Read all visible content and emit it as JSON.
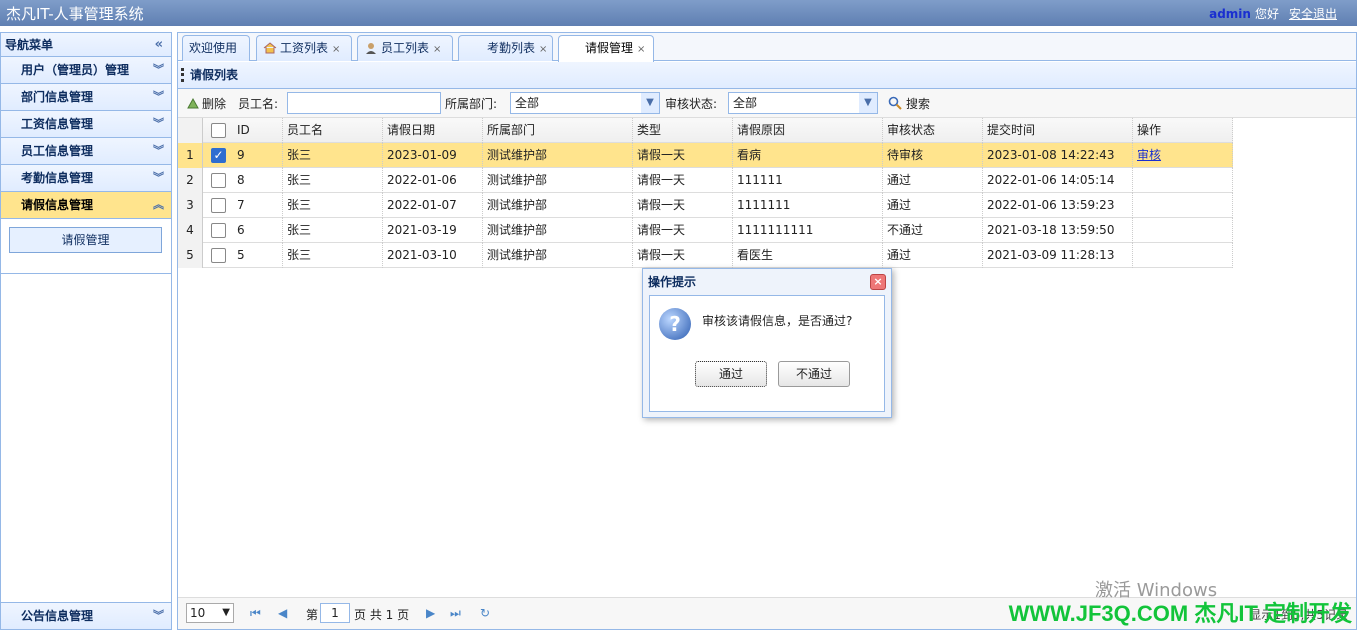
{
  "app": {
    "title": "杰凡IT-人事管理系统",
    "user": "admin",
    "greeting": "您好",
    "logout": "安全退出"
  },
  "sidebar": {
    "title": "导航菜单",
    "items": [
      {
        "label": "用户（管理员）管理"
      },
      {
        "label": "部门信息管理"
      },
      {
        "label": "工资信息管理"
      },
      {
        "label": "员工信息管理"
      },
      {
        "label": "考勤信息管理"
      },
      {
        "label": "请假信息管理"
      }
    ],
    "active_sub": "请假管理",
    "bottom_item": "公告信息管理"
  },
  "tabs": [
    {
      "label": "欢迎使用"
    },
    {
      "label": "工资列表"
    },
    {
      "label": "员工列表"
    },
    {
      "label": "考勤列表"
    },
    {
      "label": "请假管理"
    }
  ],
  "panel": {
    "title": "请假列表"
  },
  "toolbar": {
    "delete": "删除",
    "name_label": "员工名:",
    "name_value": "",
    "dept_label": "所属部门:",
    "dept_value": "全部",
    "status_label": "审核状态:",
    "status_value": "全部",
    "search": "搜索"
  },
  "table": {
    "columns": [
      "ID",
      "员工名",
      "请假日期",
      "所属部门",
      "类型",
      "请假原因",
      "审核状态",
      "提交时间",
      "操作"
    ],
    "rows": [
      {
        "num": "1",
        "id": "9",
        "name": "张三",
        "date": "2023-01-09",
        "dept": "测试维护部",
        "type": "请假一天",
        "reason": "看病",
        "status": "待审核",
        "time": "2023-01-08 14:22:43",
        "action": "审核",
        "checked": true
      },
      {
        "num": "2",
        "id": "8",
        "name": "张三",
        "date": "2022-01-06",
        "dept": "测试维护部",
        "type": "请假一天",
        "reason": "111111",
        "status": "通过",
        "time": "2022-01-06 14:05:14",
        "action": "",
        "checked": false
      },
      {
        "num": "3",
        "id": "7",
        "name": "张三",
        "date": "2022-01-07",
        "dept": "测试维护部",
        "type": "请假一天",
        "reason": "1111111",
        "status": "通过",
        "time": "2022-01-06 13:59:23",
        "action": "",
        "checked": false
      },
      {
        "num": "4",
        "id": "6",
        "name": "张三",
        "date": "2021-03-19",
        "dept": "测试维护部",
        "type": "请假一天",
        "reason": "1111111111",
        "status": "不通过",
        "time": "2021-03-18 13:59:50",
        "action": "",
        "checked": false
      },
      {
        "num": "5",
        "id": "5",
        "name": "张三",
        "date": "2021-03-10",
        "dept": "测试维护部",
        "type": "请假一天",
        "reason": "看医生",
        "status": "通过",
        "time": "2021-03-09 11:28:13",
        "action": "",
        "checked": false
      }
    ]
  },
  "pager": {
    "size": "10",
    "page_prefix": "第",
    "page": "1",
    "page_suffix": "页 共 1 页",
    "summary": "显示1到5,共5记录"
  },
  "dialog": {
    "title": "操作提示",
    "message": "审核该请假信息，是否通过?",
    "ok": "通过",
    "cancel": "不通过"
  },
  "overlay": {
    "activate": "激活 Windows",
    "watermark": "WWW.JF3Q.COM 杰凡IT 定制开发"
  }
}
